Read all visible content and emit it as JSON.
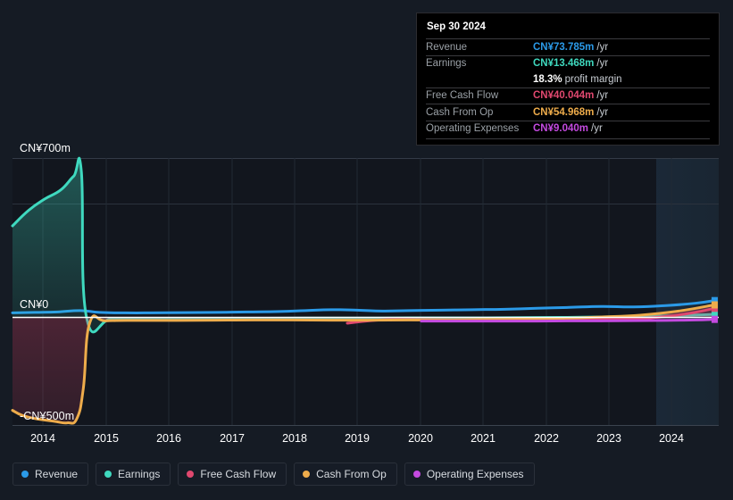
{
  "currency": "CN¥",
  "tooltip": {
    "date": "Sep 30 2024",
    "rows": [
      {
        "label": "Revenue",
        "value": "CN¥73.785m",
        "suffix": "/yr",
        "color": "#2b9ae8"
      },
      {
        "label": "Earnings",
        "value": "CN¥13.468m",
        "suffix": "/yr",
        "color": "#3fd9bf"
      },
      {
        "label": "Free Cash Flow",
        "value": "CN¥40.044m",
        "suffix": "/yr",
        "color": "#e0486f"
      },
      {
        "label": "Cash From Op",
        "value": "CN¥54.968m",
        "suffix": "/yr",
        "color": "#eeac4b"
      },
      {
        "label": "Operating Expenses",
        "value": "CN¥9.040m",
        "suffix": "/yr",
        "color": "#c44ae0"
      }
    ],
    "profit_margin_value": "18.3%",
    "profit_margin_label": "profit margin"
  },
  "legend": {
    "items": [
      {
        "label": "Revenue",
        "color": "#2b9ae8"
      },
      {
        "label": "Earnings",
        "color": "#3fd9bf"
      },
      {
        "label": "Free Cash Flow",
        "color": "#e0486f"
      },
      {
        "label": "Cash From Op",
        "color": "#eeac4b"
      },
      {
        "label": "Operating Expenses",
        "color": "#c44ae0"
      }
    ]
  },
  "axes": {
    "y_top_label": "CN¥700m",
    "y_zero_label": "CN¥0",
    "y_bottom_label": "-CN¥500m",
    "x_labels": [
      "2014",
      "2015",
      "2016",
      "2017",
      "2018",
      "2019",
      "2020",
      "2021",
      "2022",
      "2023",
      "2024"
    ]
  },
  "chart_data": {
    "type": "area",
    "title": "",
    "xlabel": "",
    "ylabel": "CN¥",
    "ylim": [
      -500,
      700
    ],
    "grid": true,
    "legend_position": "bottom",
    "x": [
      "2014",
      "2015",
      "2016",
      "2017",
      "2018",
      "2019",
      "2020",
      "2021",
      "2022",
      "2023",
      "2024"
    ],
    "xlim": [
      "2013.8",
      "2024.95"
    ],
    "series": [
      {
        "name": "Revenue",
        "color": "#2b9ae8",
        "unit": "CN¥m",
        "x": [
          2013.85,
          2014.2,
          2014.55,
          2014.9,
          2015.2,
          2015.6,
          2016.0,
          2016.5,
          2017.0,
          2017.5,
          2018.0,
          2018.4,
          2018.8,
          2019.2,
          2019.6,
          2020.0,
          2020.5,
          2021.0,
          2021.5,
          2022.0,
          2022.5,
          2023.0,
          2023.5,
          2024.0,
          2024.45,
          2024.75
        ],
        "values": [
          20,
          22,
          24,
          30,
          22,
          20,
          20,
          21,
          22,
          24,
          26,
          30,
          34,
          32,
          28,
          30,
          32,
          34,
          36,
          40,
          44,
          48,
          46,
          52,
          62,
          73.785
        ]
      },
      {
        "name": "Earnings",
        "color": "#3fd9bf",
        "unit": "CN¥m",
        "x": [
          2013.85,
          2014.1,
          2014.35,
          2014.6,
          2014.8,
          2014.92,
          2015.0,
          2015.4,
          2016.0,
          2016.6,
          2017.2,
          2017.8,
          2018.4,
          2019.0,
          2019.6,
          2020.0,
          2020.6,
          2021.2,
          2021.8,
          2022.4,
          2023.0,
          2023.6,
          2024.2,
          2024.75
        ],
        "values": [
          402,
          470,
          520,
          560,
          620,
          640,
          0,
          -6,
          -6,
          -5,
          -5,
          -4,
          -3,
          -3,
          -3,
          -2,
          -2,
          -2,
          -1,
          0,
          2,
          4,
          8,
          13.468
        ]
      },
      {
        "name": "Free Cash Flow",
        "color": "#e0486f",
        "unit": "CN¥m",
        "x": [
          2019.05,
          2019.25,
          2019.5,
          2019.8,
          2020.2,
          2020.6,
          2021.0,
          2021.5,
          2022.0,
          2022.5,
          2023.0,
          2023.5,
          2024.0,
          2024.45,
          2024.75
        ],
        "values": [
          -27,
          -20,
          -13,
          -10,
          -11,
          -12,
          -12,
          -12,
          -11,
          -10,
          -8,
          -6,
          4,
          22,
          40.044
        ]
      },
      {
        "name": "Cash From Op",
        "color": "#eeac4b",
        "unit": "CN¥m",
        "x": [
          2013.85,
          2014.0,
          2014.2,
          2014.5,
          2014.7,
          2014.85,
          2014.95,
          2015.05,
          2015.3,
          2015.8,
          2016.4,
          2017.0,
          2017.6,
          2018.2,
          2018.8,
          2019.4,
          2020.0,
          2020.6,
          2021.2,
          2021.8,
          2022.4,
          2023.0,
          2023.6,
          2024.2,
          2024.75
        ],
        "values": [
          -432,
          -455,
          -470,
          -483,
          -490,
          -470,
          -330,
          -25,
          -16,
          -14,
          -14,
          -13,
          -12,
          -12,
          -13,
          -13,
          -12,
          -12,
          -10,
          -8,
          -4,
          2,
          10,
          28,
          54.968
        ]
      },
      {
        "name": "Operating Expenses",
        "color": "#c44ae0",
        "unit": "CN¥m",
        "x": [
          2020.2,
          2020.6,
          2021.0,
          2021.5,
          2022.0,
          2022.5,
          2023.0,
          2023.5,
          2024.0,
          2024.45,
          2024.75
        ],
        "values": [
          -17,
          -17,
          -17,
          -17,
          -17,
          -16,
          -16,
          -15,
          -14,
          -12,
          -9.04
        ]
      }
    ]
  }
}
